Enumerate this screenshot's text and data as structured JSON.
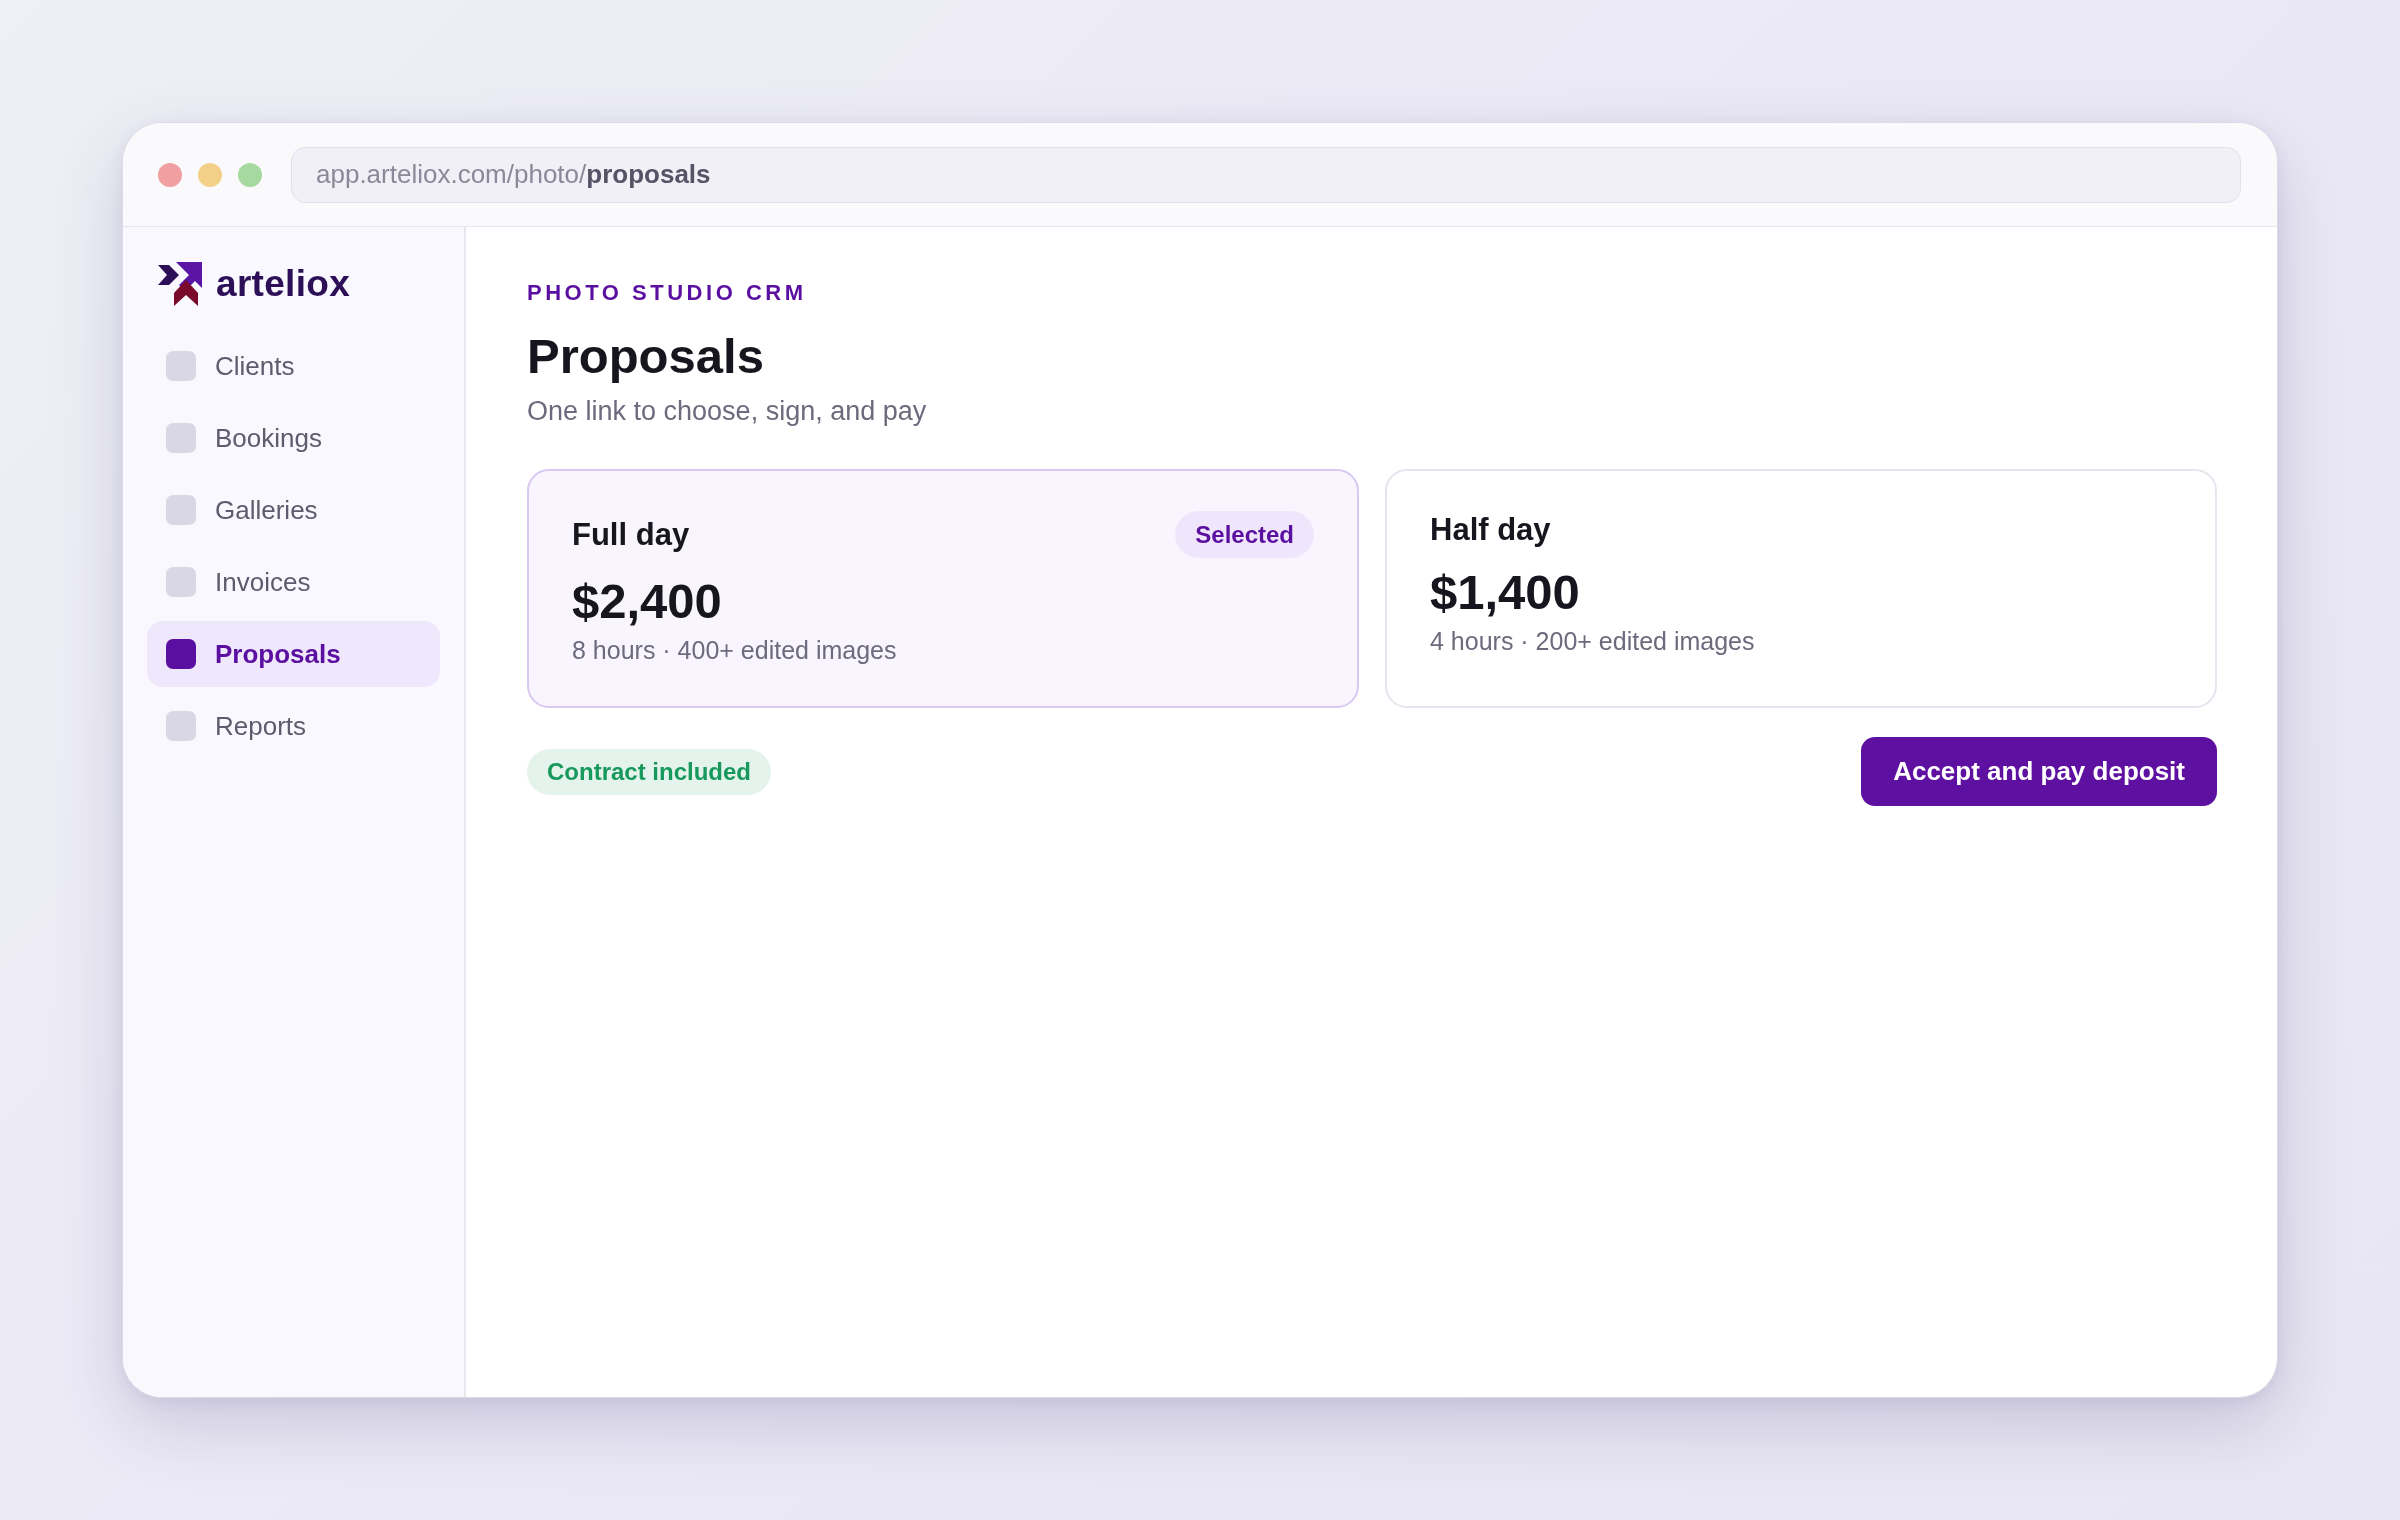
{
  "browser": {
    "address": "app.arteliox.com/photo/**proposals**"
  },
  "sidebar": {
    "brand": "arteliox",
    "items": [
      {
        "label": "Clients",
        "selected": false
      },
      {
        "label": "Bookings",
        "selected": false
      },
      {
        "label": "Galleries",
        "selected": false
      },
      {
        "label": "Invoices",
        "selected": false
      },
      {
        "label": "Proposals",
        "selected": true
      },
      {
        "label": "Reports",
        "selected": false
      }
    ]
  },
  "header": {
    "eyebrow": "PHOTO STUDIO CRM",
    "title": "Proposals",
    "subtitle": "One link to choose, sign, and pay"
  },
  "packages": [
    {
      "name": "Full day",
      "price": "$2,400",
      "details": "8 hours · 400+ edited images",
      "selected": true,
      "badge": "Selected"
    },
    {
      "name": "Half day",
      "price": "$1,400",
      "details": "4 hours · 200+ edited images",
      "selected": false
    }
  ],
  "footer": {
    "tag": "Contract included",
    "action": "Accept and pay deposit"
  }
}
